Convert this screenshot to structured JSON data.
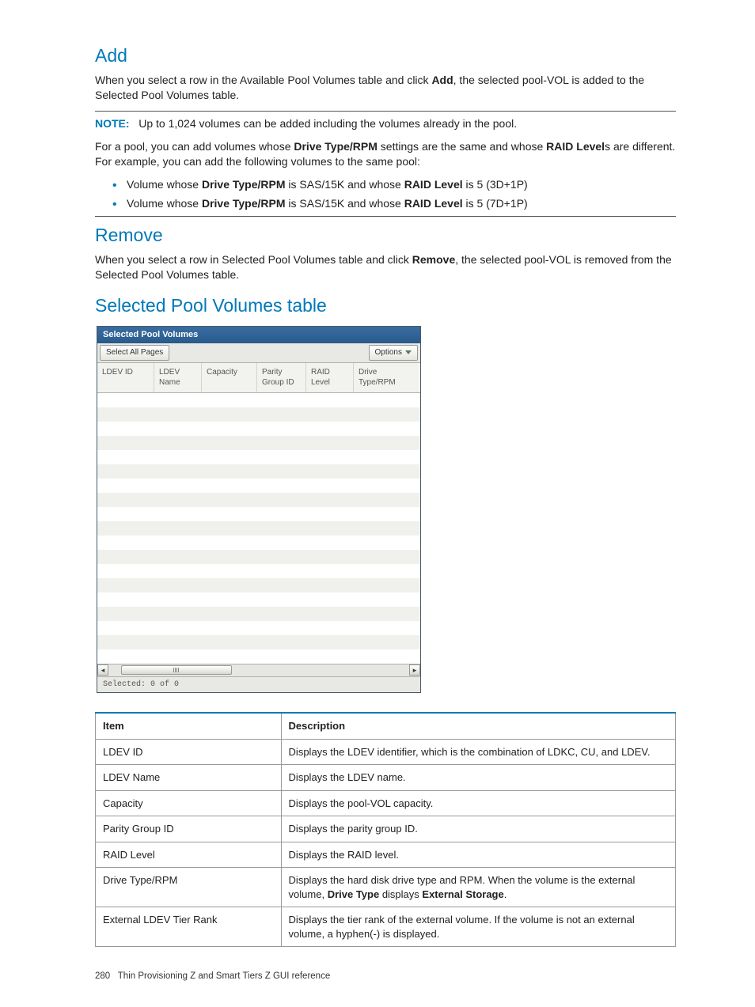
{
  "sections": {
    "add": {
      "title": "Add",
      "p1_a": "When you select a row in the Available Pool Volumes table and click ",
      "p1_bold": "Add",
      "p1_b": ", the selected pool-VOL is added to the Selected Pool Volumes table.",
      "note_label": "NOTE:",
      "note_text": "Up to 1,024 volumes can be added including the volumes already in the pool.",
      "p2_a": "For a pool, you can add volumes whose ",
      "p2_bold1": "Drive Type/RPM",
      "p2_b": " settings are the same and whose ",
      "p2_bold2": "RAID Level",
      "p2_c": "s are different. For example, you can add the following volumes to the same pool:",
      "bullets": [
        {
          "a": "Volume whose ",
          "b1": "Drive Type/RPM",
          "b": " is SAS/15K and whose ",
          "b2": "RAID Level",
          "c": " is 5 (3D+1P)"
        },
        {
          "a": "Volume whose ",
          "b1": "Drive Type/RPM",
          "b": " is SAS/15K and whose ",
          "b2": "RAID Level",
          "c": " is 5 (7D+1P)"
        }
      ]
    },
    "remove": {
      "title": "Remove",
      "p1_a": "When you select a row in Selected Pool Volumes table and click ",
      "p1_bold": "Remove",
      "p1_b": ", the selected pool-VOL is removed from the Selected Pool Volumes table."
    },
    "spv": {
      "title": "Selected Pool Volumes table"
    }
  },
  "widget": {
    "title": "Selected Pool Volumes",
    "select_all": "Select All Pages",
    "options": "Options",
    "columns": [
      "LDEV ID",
      "LDEV Name",
      "Capacity",
      "Parity Group ID",
      "RAID Level",
      "Drive Type/RPM"
    ],
    "footer": "Selected: 0   of  0"
  },
  "desc_table": {
    "headers": [
      "Item",
      "Description"
    ],
    "rows": [
      {
        "item": "LDEV ID",
        "desc": "Displays the LDEV identifier, which is the combination of LDKC, CU, and LDEV."
      },
      {
        "item": "LDEV Name",
        "desc": "Displays the LDEV name."
      },
      {
        "item": "Capacity",
        "desc": "Displays the pool-VOL capacity."
      },
      {
        "item": "Parity Group ID",
        "desc": "Displays the parity group ID."
      },
      {
        "item": "RAID Level",
        "desc": "Displays the RAID level."
      },
      {
        "item": "Drive Type/RPM",
        "desc_a": "Displays the hard disk drive type and RPM. When the volume is the external volume, ",
        "desc_b1": "Drive Type",
        "desc_mid": " displays ",
        "desc_b2": "External Storage",
        "desc_c": "."
      },
      {
        "item": "External LDEV Tier Rank",
        "desc": "Displays the tier rank of the external volume. If the volume is not an external volume, a hyphen(-) is displayed."
      }
    ]
  },
  "footer": {
    "page": "280",
    "label": "Thin Provisioning Z and Smart Tiers Z GUI reference"
  }
}
